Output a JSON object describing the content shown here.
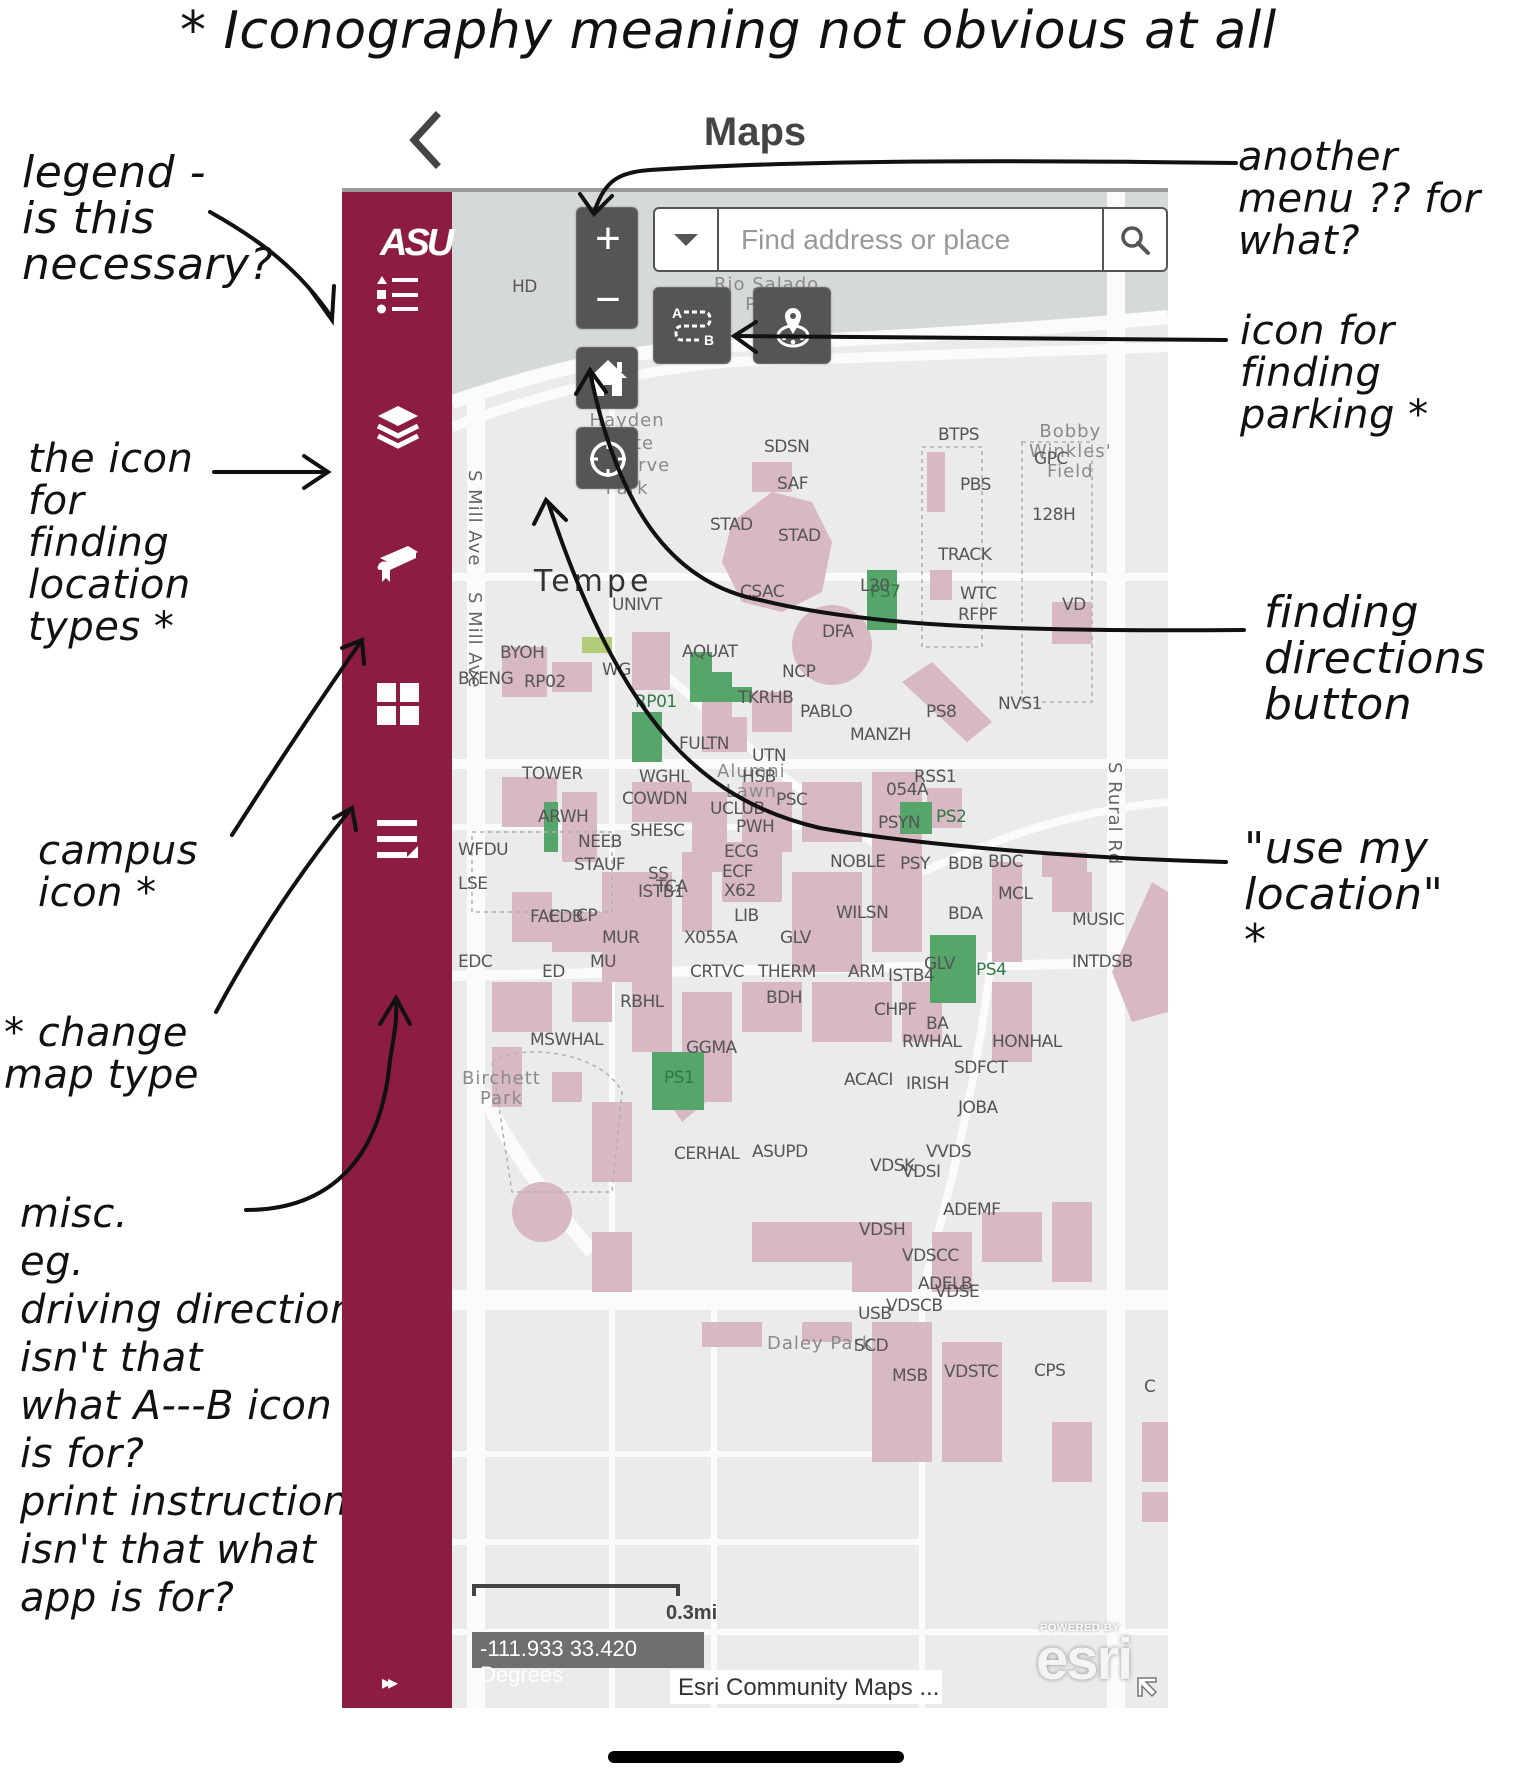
{
  "annotations": {
    "title": "* Iconography meaning  not obvious at all",
    "legend": "legend -\nis this\nnecessary?",
    "layers": "the icon\n for\nfinding\nlocation\ntypes *",
    "campus": "campus\n icon *",
    "map_type": "* change\n  map type",
    "misc": "misc.\n eg.\ndriving directions;\nisn't  that\n what  A---B icon\n  is for?\n print instructions?\n isn't that  what\n   app is for?",
    "another_menu": "another\n menu ?? for\n   what?",
    "parking": "icon for\nfinding\n parking *",
    "directions": "finding\ndirections\n button",
    "my_location": "\"use my\n  location\"\n *"
  },
  "header": {
    "title": "Maps",
    "back_icon": "chevron-left-icon"
  },
  "sidebar": {
    "logo": "ASU",
    "items": [
      {
        "name": "legend",
        "icon": "legend-list-icon"
      },
      {
        "name": "layers",
        "icon": "layers-stack-icon"
      },
      {
        "name": "campus",
        "icon": "graduation-cap-icon"
      },
      {
        "name": "basemap",
        "icon": "grid-four-icon"
      },
      {
        "name": "misc",
        "icon": "text-lines-icon"
      }
    ],
    "expand_label": "▸▸"
  },
  "map": {
    "search": {
      "placeholder": "Find address or place",
      "value": ""
    },
    "controls": {
      "zoom_in": "+",
      "zoom_out": "−"
    },
    "scale_label": "0.3mi",
    "coordinates": "-111.933 33.420 Degrees",
    "attribution": "Esri Community Maps ...",
    "esri_powered": "POWERED BY",
    "esri_logo": "esri",
    "city_label": "Tempe",
    "parks": [
      {
        "label": "Rio Salado\nPark"
      },
      {
        "label": "Hayden\nButte\nPreserve\nPark"
      },
      {
        "label": "Bobby\nWinkles'\nField"
      },
      {
        "label": "Alumni\nLawn"
      },
      {
        "label": "Birchett\nPark"
      },
      {
        "label": "Daley Park"
      }
    ],
    "roads": [
      {
        "label": "S Mill Ave"
      },
      {
        "label": "S Mill Ave"
      },
      {
        "label": "S Rural Rd"
      }
    ],
    "parking_labels": [
      "PS7",
      "PS2",
      "PS4",
      "PS1",
      "RP01"
    ],
    "buildings": [
      "HD",
      "SDSN",
      "SAF",
      "STAD",
      "STAD",
      "BTPS",
      "PBS",
      "GPC",
      "128H",
      "TRACK",
      "WTC",
      "RFPF",
      "VD",
      "CSAC",
      "L20",
      "DFA",
      "UNIVT",
      "BYOH",
      "BYENG",
      "RP02",
      "WG",
      "AQUAT",
      "NCP",
      "TKRHB",
      "PABLO",
      "MANZH",
      "PS8",
      "NVS1",
      "FULTN",
      "UTN",
      "TOWER",
      "WGHL",
      "COWDN",
      "HSB",
      "UCLUB",
      "PSC",
      "054A",
      "RSS1",
      "ARWH",
      "SHESC",
      "PWH",
      "PSYN",
      "WFDU",
      "NEEB",
      "STAUF",
      "ECG",
      "ECF",
      "NOBLE",
      "PSY",
      "BDB",
      "BDC",
      "SS",
      "LSE",
      "MCL",
      "TCA",
      "X62",
      "CP",
      "LIB",
      "BDA",
      "FAC",
      "EDB",
      "ISTB1",
      "WILSN",
      "MUR",
      "X055A",
      "GLV",
      "MUSIC",
      "EDC",
      "ED",
      "MU",
      "CRTVC",
      "THERM",
      "BDH",
      "ARM",
      "ISTB4",
      "GLV",
      "INTDSB",
      "RBHL",
      "CHPF",
      "BA",
      "GGMA",
      "MSWHAL",
      "RWHAL",
      "HONHAL",
      "SDFCT",
      "ACACI",
      "IRISH",
      "JOBA",
      "CERHAL",
      "ASUPD",
      "VVDS",
      "VDSK",
      "VDSI",
      "ADEMF",
      "VDSH",
      "VDSCC",
      "ADELB",
      "VDSCB",
      "VDSE",
      "SCD",
      "USB",
      "VDSTC",
      "CPS",
      "MSB",
      "C"
    ]
  },
  "colors": {
    "sidebar": "#8c1d40",
    "control": "#555555",
    "building": "#d7b8c3",
    "parking": "#56a56a",
    "map_bg": "#ebebeb",
    "road": "#fbfbfb"
  }
}
